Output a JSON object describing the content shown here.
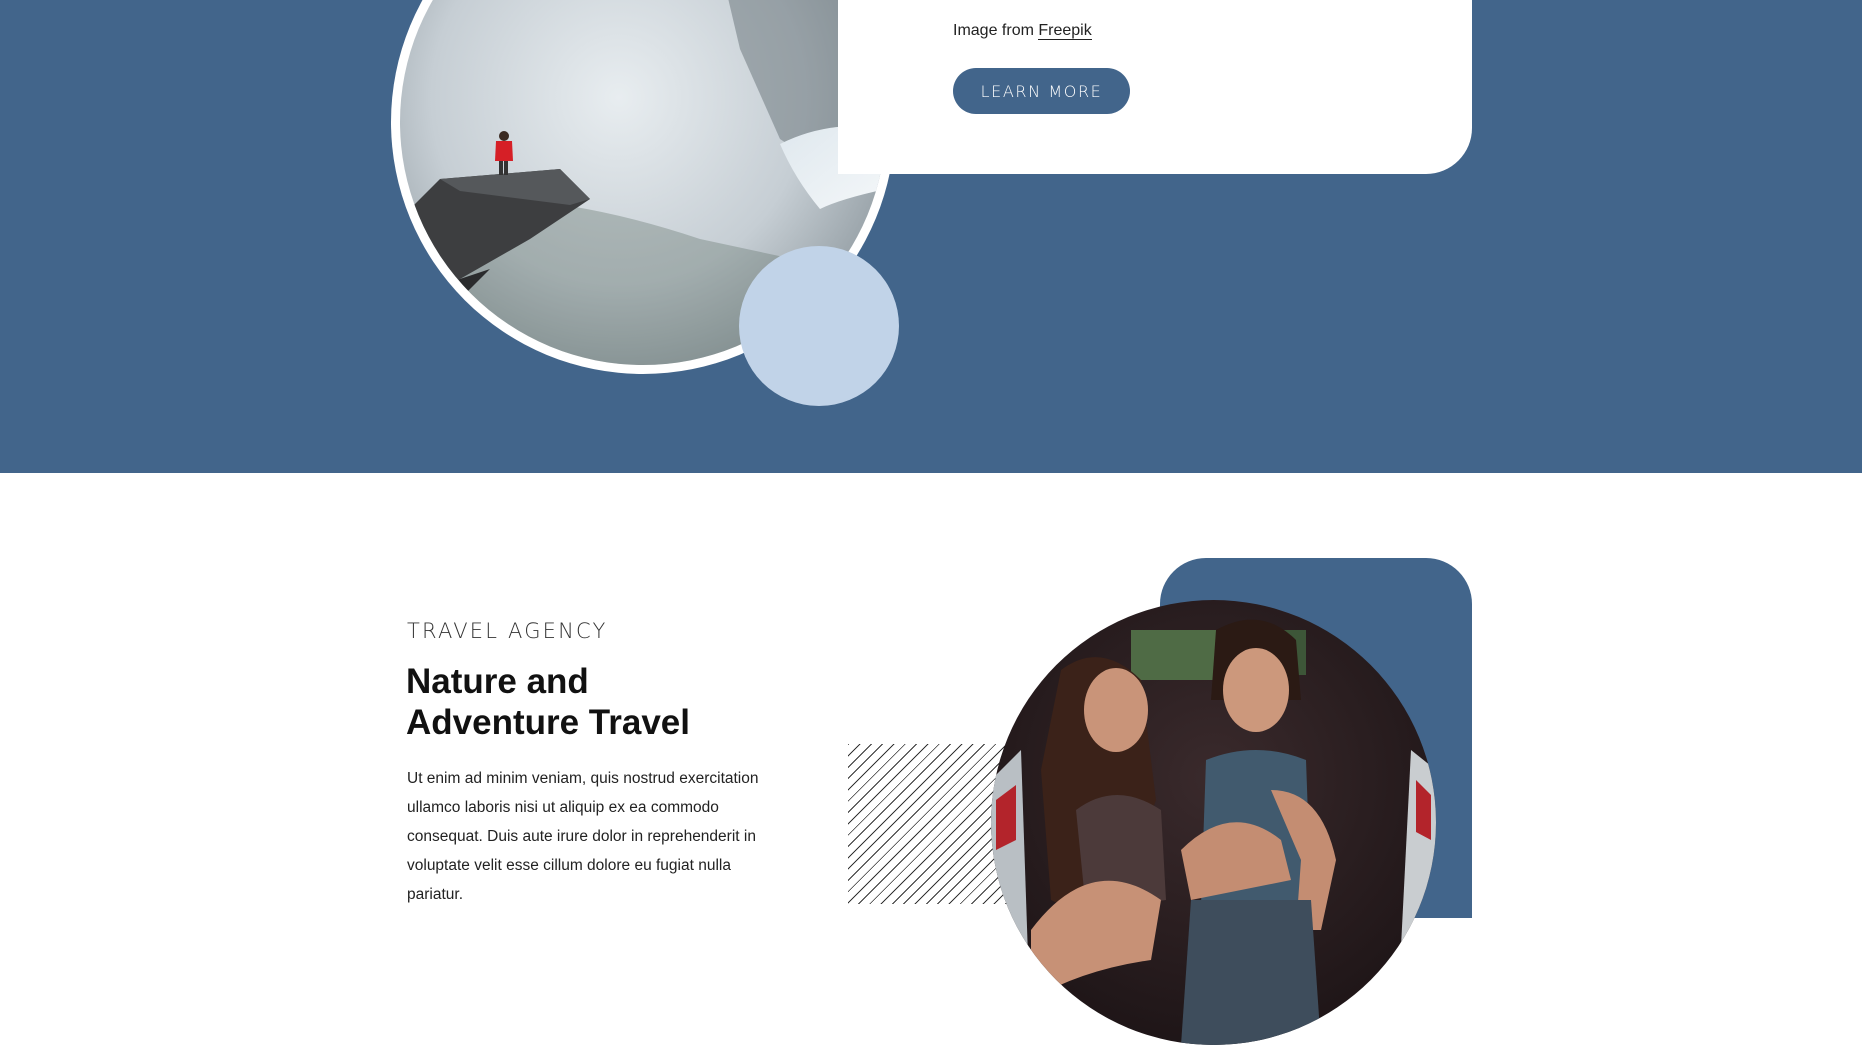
{
  "hero": {
    "caption_prefix": "Image from",
    "caption_link": "Freepik",
    "learn_more_label": "LEARN MORE"
  },
  "travel": {
    "eyebrow": "TRAVEL AGENCY",
    "title_line1": "Nature and",
    "title_line2": "Adventure Travel",
    "body": "Ut enim ad minim veniam, quis nostrud exercitation ullamco laboris nisi ut aliquip ex ea commodo consequat. Duis aute irure dolor in reprehenderit in voluptate velit esse cillum dolore eu fugiat nulla pariatur."
  },
  "colors": {
    "brand_blue": "#42658b",
    "light_blue": "#c1d3e8",
    "white": "#ffffff"
  }
}
